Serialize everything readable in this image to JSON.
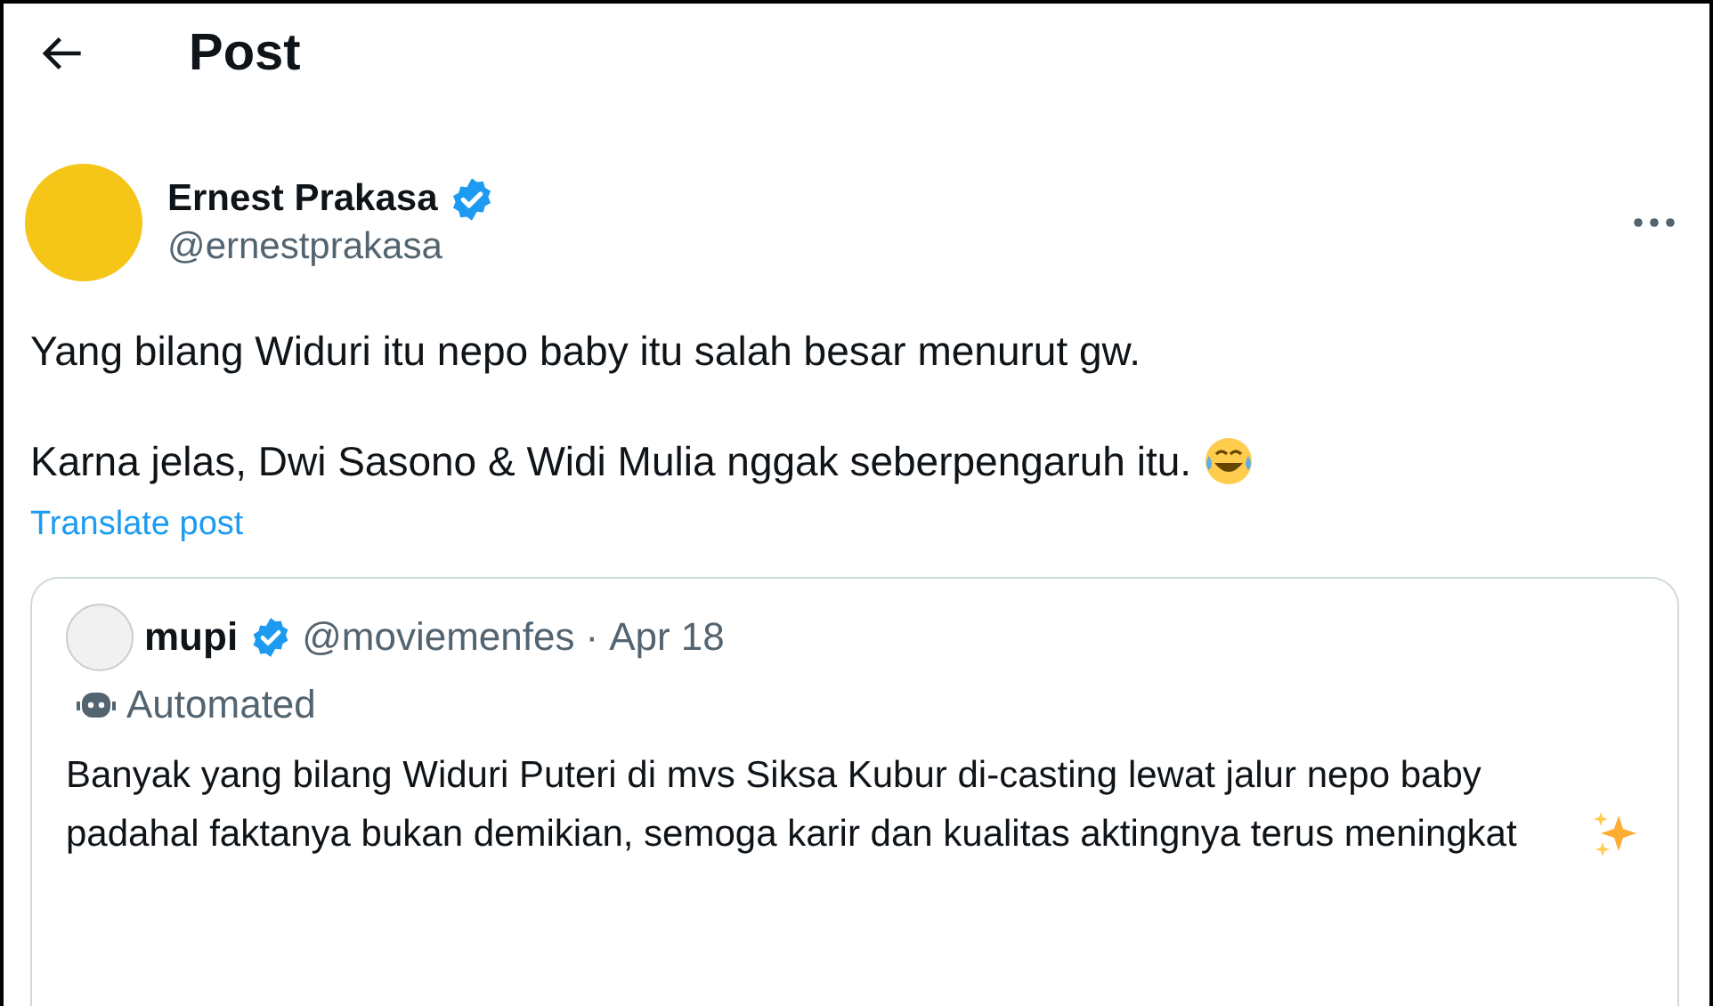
{
  "header": {
    "title": "Post"
  },
  "post": {
    "author": {
      "name": "Ernest Prakasa",
      "verified": true,
      "handle": "@ernestprakasa"
    },
    "paragraphs": [
      {
        "kind": "plain",
        "text": "Yang bilang Widuri itu nepo baby itu salah besar menurut gw."
      },
      {
        "kind": "laughing",
        "text": "Karna jelas, Dwi Sasono & Widi Mulia nggak seberpengaruh itu."
      }
    ],
    "translate": "Translate post",
    "quote": {
      "author": {
        "name": "mupi",
        "verified": true,
        "handle": "@moviemenfes",
        "separator": "·",
        "date": "Apr 18"
      },
      "label": "Automated",
      "kind": "sparkles",
      "text": "Banyak yang bilang Widuri Puteri di mvs Siksa Kubur di-casting lewat jalur nepo baby padahal faktanya bukan demikian, semoga karir dan kualitas aktingnya terus meningkat"
    }
  }
}
